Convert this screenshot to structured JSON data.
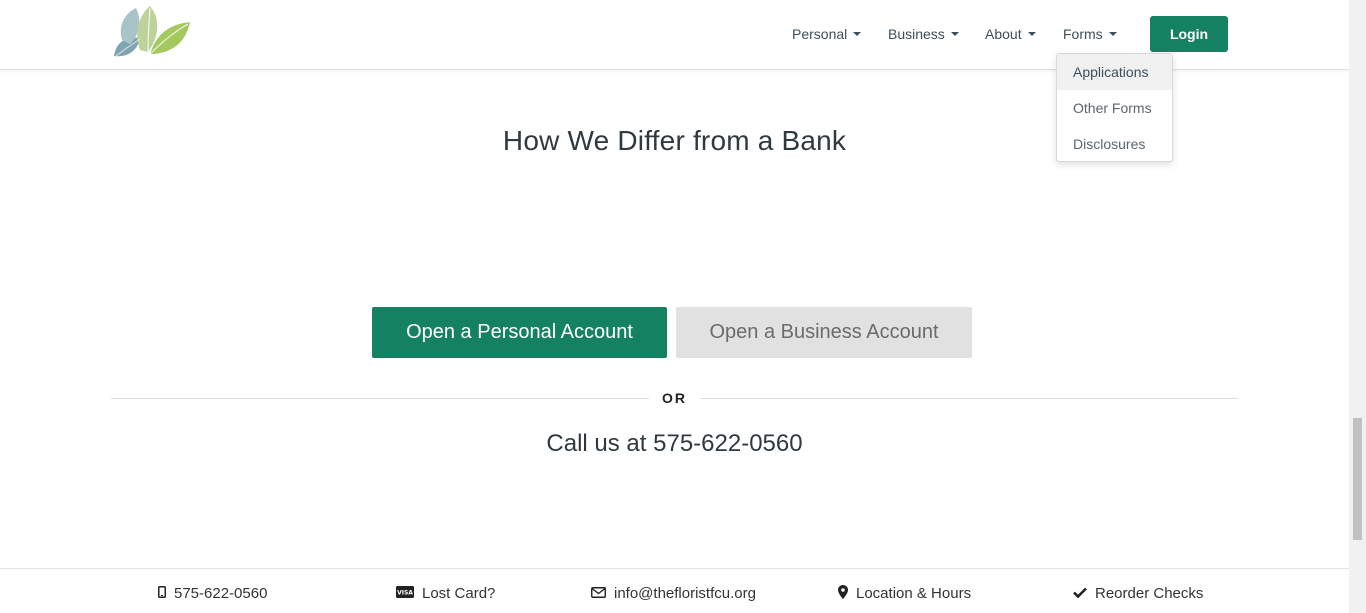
{
  "header": {
    "nav": [
      {
        "label": "Personal"
      },
      {
        "label": "Business"
      },
      {
        "label": "About"
      },
      {
        "label": "Forms"
      }
    ],
    "login_label": "Login",
    "forms_dropdown": [
      {
        "label": "Applications"
      },
      {
        "label": "Other Forms"
      },
      {
        "label": "Disclosures"
      }
    ]
  },
  "main": {
    "heading": "How We Differ from a Bank",
    "personal_button": "Open a Personal Account",
    "business_button": "Open a Business Account",
    "or_label": "OR",
    "call_text": "Call us at 575-622-0560"
  },
  "footer": {
    "phone": "575-622-0560",
    "lost_card": "Lost Card?",
    "email": "info@thefloristfcu.org",
    "location": "Location & Hours",
    "reorder": "Reorder Checks"
  },
  "colors": {
    "brand_green": "#148262",
    "secondary_button": "#e1e1e1"
  },
  "icons": [
    "leaf-logo",
    "caret-down-icon",
    "mobile-phone-icon",
    "visa-card-icon",
    "envelope-icon",
    "map-marker-icon",
    "checkmark-icon"
  ]
}
